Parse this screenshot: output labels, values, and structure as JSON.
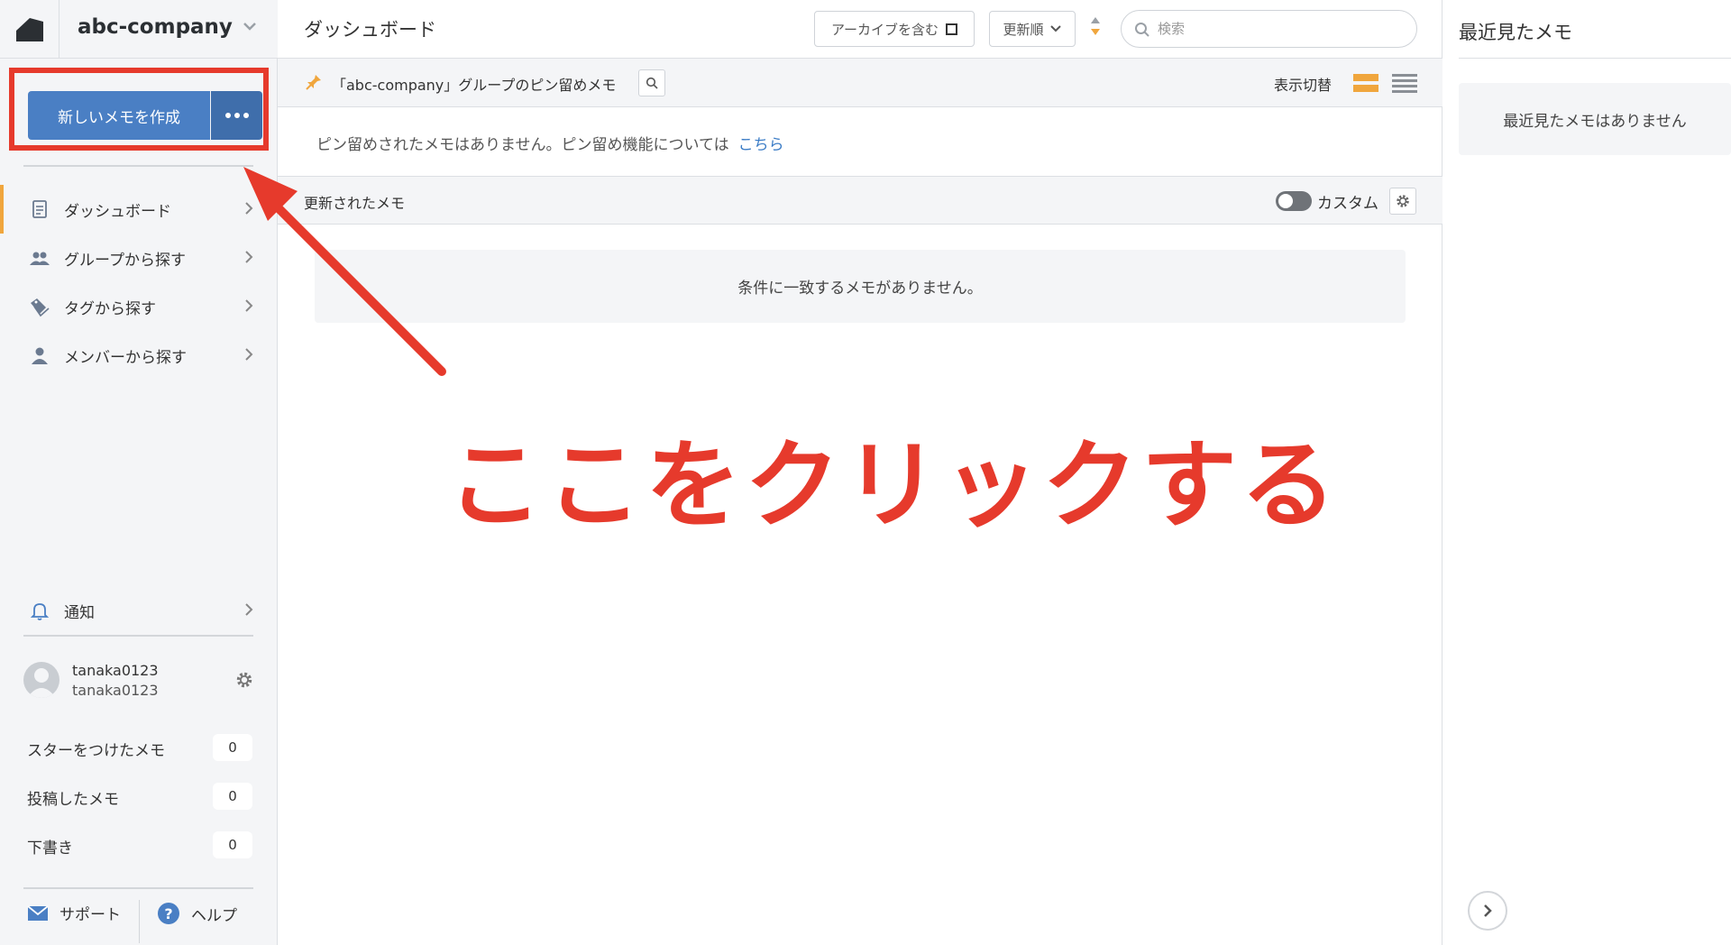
{
  "brand": {
    "name": "abc-company"
  },
  "sidebar": {
    "create_button": "新しいメモを作成",
    "nav": [
      {
        "label": "ダッシュボード",
        "icon": "document-icon"
      },
      {
        "label": "グループから探す",
        "icon": "group-icon"
      },
      {
        "label": "タグから探す",
        "icon": "tag-icon"
      },
      {
        "label": "メンバーから探す",
        "icon": "member-icon"
      }
    ],
    "notification": "通知",
    "user": {
      "name": "tanaka0123",
      "id": "tanaka0123"
    },
    "counts": [
      {
        "label": "スターをつけたメモ",
        "value": "0"
      },
      {
        "label": "投稿したメモ",
        "value": "0"
      },
      {
        "label": "下書き",
        "value": "0"
      }
    ],
    "footer": {
      "support": "サポート",
      "help": "ヘルプ"
    }
  },
  "header": {
    "title": "ダッシュボード",
    "archive_label": "アーカイブを含む",
    "sort_label": "更新順",
    "search_placeholder": "検索"
  },
  "pinned": {
    "title": "「abc-company」グループのピン留めメモ",
    "view_toggle_label": "表示切替",
    "empty_text": "ピン留めされたメモはありません。ピン留め機能については",
    "link_text": "こちら"
  },
  "updated": {
    "title": "更新されたメモ",
    "custom_label": "カスタム",
    "empty_text": "条件に一致するメモがありません。"
  },
  "right_panel": {
    "title": "最近見たメモ",
    "empty_text": "最近見たメモはありません"
  },
  "annotation": {
    "text": "ここをクリックする"
  },
  "colors": {
    "accent_blue": "#4a7fc4",
    "annotation_red": "#e63a2c",
    "active_orange": "#f0a63d",
    "link_blue": "#3b7cc6"
  }
}
